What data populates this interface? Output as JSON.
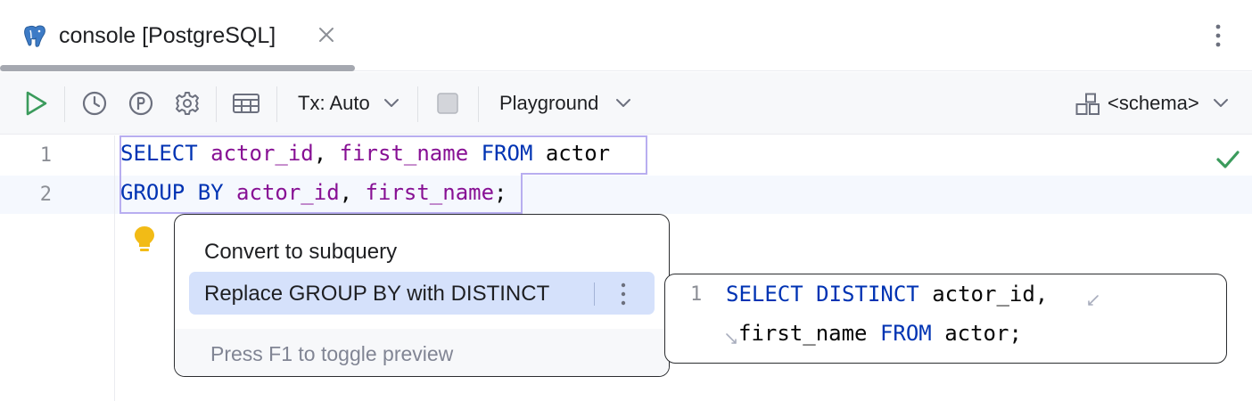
{
  "tab": {
    "title": "console [PostgreSQL]",
    "icon": "postgresql-elephant-icon"
  },
  "toolbar": {
    "tx_label": "Tx: Auto",
    "playground_label": "Playground",
    "schema_label": "<schema>"
  },
  "editor": {
    "lines": [
      {
        "number": "1",
        "tokens": {
          "t1": "SELECT",
          "t2": " ",
          "t3": "actor_id",
          "t4": ", ",
          "t5": "first_name",
          "t6": " ",
          "t7": "FROM",
          "t8": " actor"
        }
      },
      {
        "number": "2",
        "tokens": {
          "t1": "GROUP BY",
          "t2": " ",
          "t3": "actor_id",
          "t4": ", ",
          "t5": "first_name",
          "t6": ";"
        }
      }
    ]
  },
  "intention_popup": {
    "items": [
      "Convert to subquery",
      "Replace GROUP BY with DISTINCT"
    ],
    "selected_index": 1,
    "hint": "Press F1 to toggle preview"
  },
  "preview": {
    "line_number": "1",
    "line1": {
      "kw1": "SELECT",
      "sp": " ",
      "kw2": "DISTINCT",
      "rest": " actor_id,"
    },
    "line2": {
      "a": "first_name ",
      "kw": "FROM",
      "b": " actor;"
    }
  },
  "colors": {
    "keyword": "#0033b3",
    "identifier": "#871094",
    "selection_bg": "#d5e1fb",
    "run_green": "#3b9b5c",
    "ok_green": "#3b9b5c",
    "bulb_yellow": "#f2bb16"
  }
}
